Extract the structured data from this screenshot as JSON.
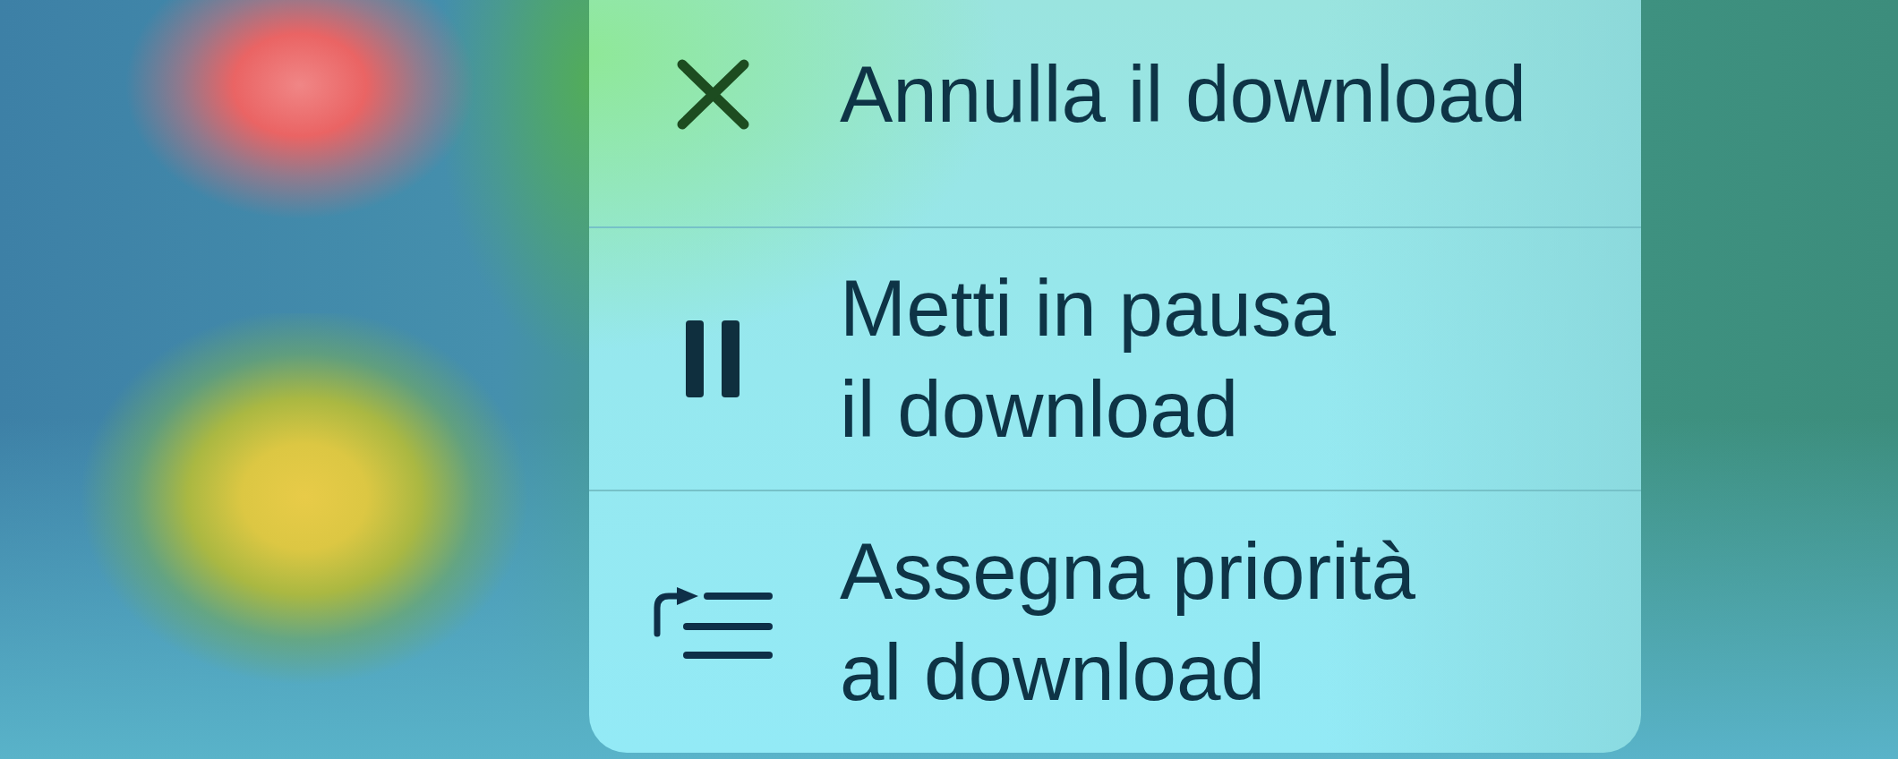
{
  "menu": {
    "items": [
      {
        "kind": "close",
        "label": "Annulla il download"
      },
      {
        "kind": "pause",
        "label": "Metti in pausa\nil download"
      },
      {
        "kind": "priority",
        "label": "Assegna priorità\nal download"
      }
    ]
  }
}
